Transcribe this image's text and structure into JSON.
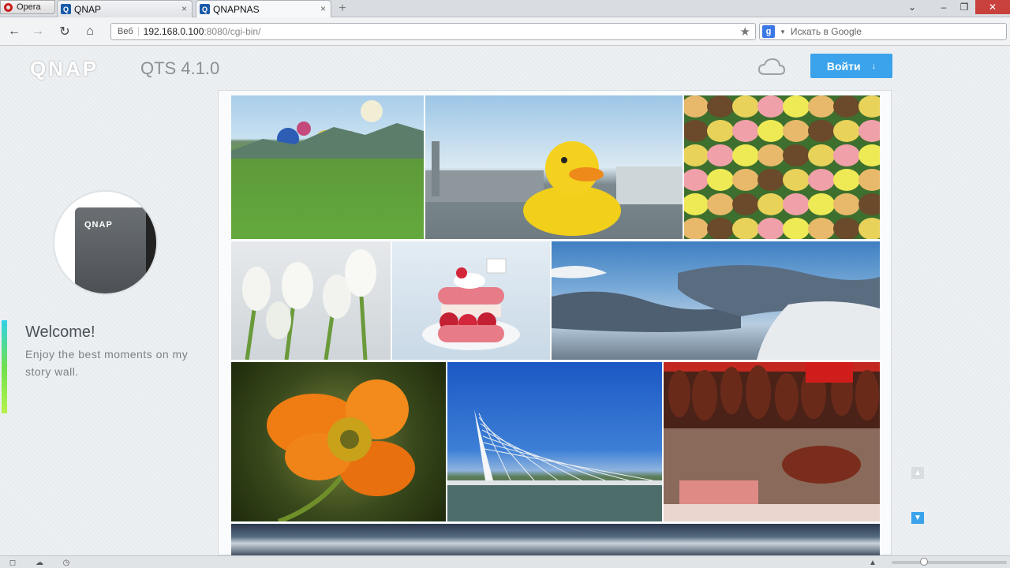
{
  "browser": {
    "menu_label": "Opera",
    "tabs": [
      {
        "label": "QNAP",
        "close": "×"
      },
      {
        "label": "QNAPNAS",
        "close": "×"
      }
    ],
    "new_tab": "+",
    "window_controls": [
      "⌄",
      "–",
      "❐",
      "✕"
    ],
    "nav": {
      "back": "←",
      "forward": "→",
      "reload": "↻",
      "home": "⌂"
    },
    "address": {
      "label": "Веб",
      "host": "192.168.0.100",
      "path": ":8080/cgi-bin/",
      "star": "★"
    },
    "search": {
      "engine": "g",
      "placeholder": "Искать в Google"
    }
  },
  "page": {
    "logo": "QNAP",
    "product": "QTS 4.1.0",
    "login_label": "Войти",
    "login_arrow": "↓",
    "avatar_brand": "QNAP",
    "welcome_title": "Welcome!",
    "welcome_subtitle": "Enjoy the best moments on my story wall.",
    "photos": [
      "balloons",
      "rubber-duck",
      "macarons",
      "tulips",
      "dessert",
      "sky",
      "poppy",
      "bridge",
      "market-hams",
      "clouds"
    ],
    "scroll_up": "▲",
    "scroll_down": "▼"
  },
  "status": {
    "icons": [
      "◻",
      "☁",
      "◷"
    ],
    "right_arrow": "▲"
  }
}
